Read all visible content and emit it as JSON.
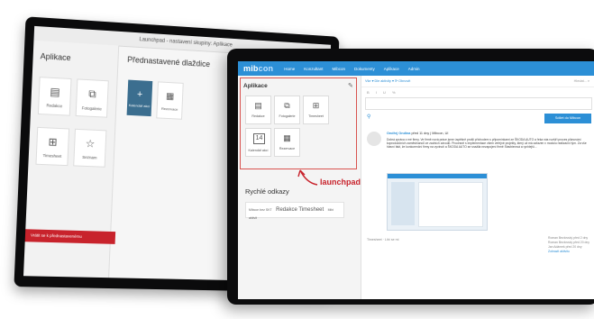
{
  "back_screen": {
    "title": "Launchpad - nastavení skupiny: Aplikace",
    "left_section_title": "Aplikace",
    "left_tiles": [
      {
        "label": "Redakce",
        "icon": "document-icon"
      },
      {
        "label": "Fotogalerie",
        "icon": "photos-icon"
      },
      {
        "label": "Timesheet",
        "icon": "grid-icon"
      },
      {
        "label": "Seznam",
        "icon": "star-icon"
      }
    ],
    "right_section_title": "Přednastavené dlaždice",
    "right_tiles": [
      {
        "label": "Kalendář akcí",
        "icon": "plus-icon"
      },
      {
        "label": "Rezervace",
        "icon": "calendar-icon"
      }
    ],
    "red_button": "Vrátit se k přednastavenému"
  },
  "front": {
    "logo": {
      "main": "mib",
      "accent": "con"
    },
    "nav": [
      "Home",
      "Konzultant",
      "Mibcon",
      "Dokumenty",
      "Aplikace",
      "Admin"
    ],
    "launchpad": {
      "title": "Aplikace",
      "tiles": [
        {
          "label": "Redakce",
          "icon": "document-icon"
        },
        {
          "label": "Fotogalerie",
          "icon": "photos-icon"
        },
        {
          "label": "Timesheet",
          "icon": "grid-icon"
        },
        {
          "label": "Kalendář akcí",
          "icon": "calendar-14-icon",
          "glyph": "14"
        },
        {
          "label": "Rezervace",
          "icon": "calendar-icon"
        }
      ]
    },
    "quick_links": {
      "title": "Rychlé odkazy",
      "item_prefix": "Mibcon bez SKT",
      "item_main": "Redakce Timesheet",
      "item_suffix": "Mibi aktivit"
    },
    "callout": "launchpad",
    "feed": {
      "bar_text": "Vše ▾  Dle aktivity ▾  ⟳ Obnovit",
      "search": "Hledat...",
      "format_icons": "B I U %",
      "share_button": "Sdílet do Mibcon",
      "post_author": "Ondřej Ondina",
      "post_meta": "před 11 dny | Mibcon, UI",
      "post_text": "Dobrá zpráva z mé firmy. Ve firmě nová práce jsme úspěšně prošli příchodem s připomínkami ze ŠKODA AUTO a řeka nás rozšíří proces plánování koprodukčních zaměstnanců ze zadních závodů. Procesně s implementace všem veřejné projekty, který už má zařazen v modulu realizační tým. Za vše hlavní fakt, že konkurenční firmy na vyvinutí a ŠKODA AUTO se snažila nezapojení firmě Stavbierová a rychlejší...",
      "post_footer": "Timesheet · Líbí se mi",
      "activity": [
        "Roman Bezlovský před 2 dny",
        "Roman Bezlovský před 20 dny",
        "Jan Adámek před 20 dny"
      ],
      "activity_link": "Zobrazit aktivitu"
    }
  },
  "colors": {
    "brand_blue": "#2c8fd6",
    "accent_red": "#c8232c",
    "tile_active": "#3b6e8f"
  }
}
